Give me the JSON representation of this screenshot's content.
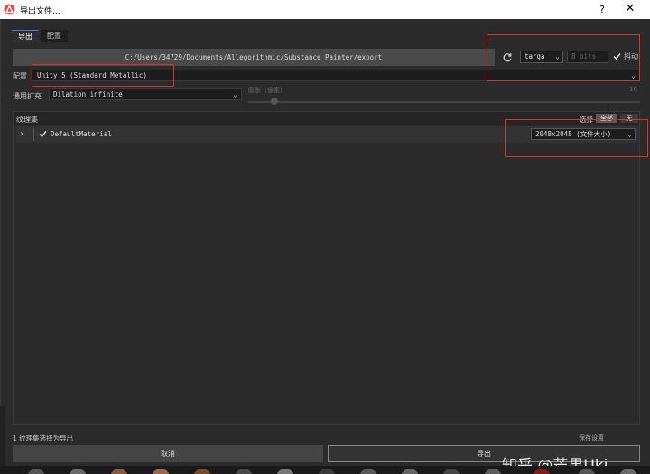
{
  "window": {
    "title": "导出文件...",
    "help_label": "?",
    "close_label": "✕"
  },
  "tabs": [
    {
      "label": "导出",
      "active": true
    },
    {
      "label": "配置",
      "active": false
    }
  ],
  "path": {
    "value": "C:/Users/34729/Documents/Allegorithmic/Substance Painter/export"
  },
  "format": {
    "file_type": "targa",
    "bit_depth_placeholder": "8 bits",
    "padding_label": "抖动",
    "padding_checked": true
  },
  "config": {
    "label": "配置",
    "value": "Unity 5 (Standard Metallic)"
  },
  "padding": {
    "label": "通用扩充",
    "value": "Dilation infinite",
    "dilation_label": "膨胀（像素）",
    "dilation_value": "16"
  },
  "output": {
    "title": "纹理集",
    "select_label": "选择",
    "all_label": "全部",
    "none_label": "无",
    "rows": [
      {
        "name": "DefaultMaterial",
        "checked": true,
        "size": "2048x2048 (文件大小)"
      }
    ]
  },
  "footer": {
    "status": "1 纹理集选择为导出",
    "status_right": "保存设置",
    "cancel_label": "取消",
    "export_label": "导出"
  },
  "watermark": "知乎 @芒果Uki",
  "colors": {
    "accent": "#3d7bd9",
    "highlight_box": "#d9322e",
    "background": "#2b2b2b"
  }
}
